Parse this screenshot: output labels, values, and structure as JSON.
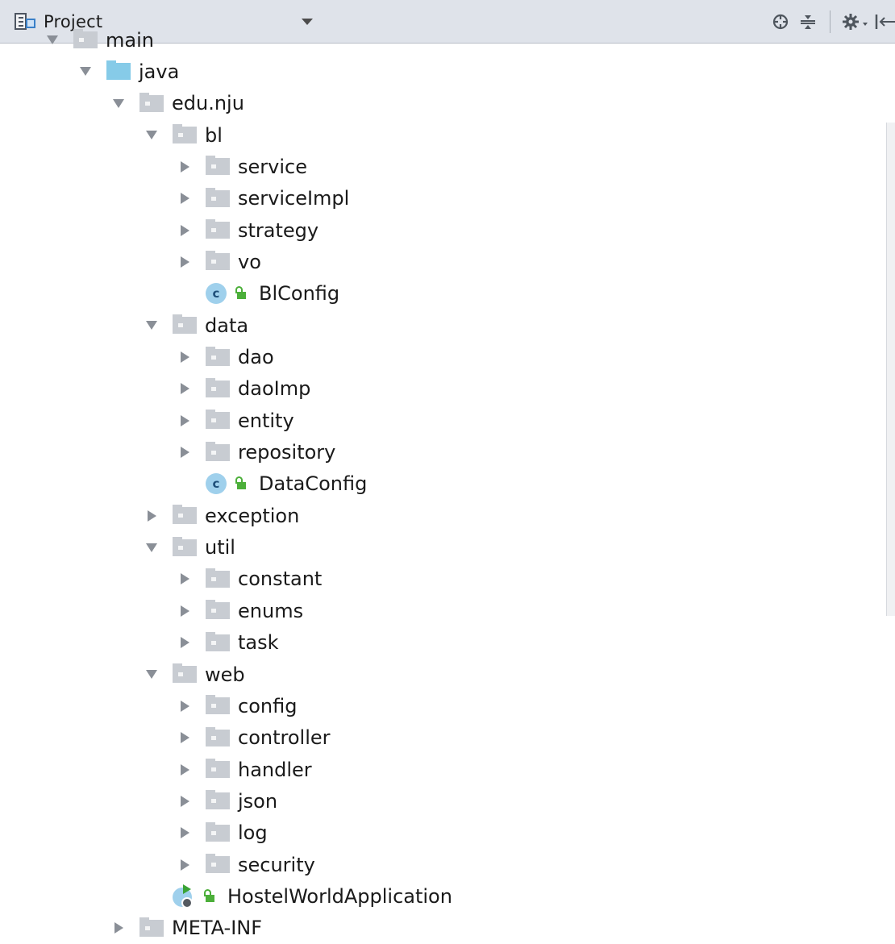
{
  "panel": {
    "title": "Project"
  },
  "tree": [
    {
      "label": "main",
      "level": 2,
      "arrow": "down",
      "icon": "folder"
    },
    {
      "label": "java",
      "level": 3,
      "arrow": "down",
      "icon": "folder-source"
    },
    {
      "label": "edu.nju",
      "level": 4,
      "arrow": "down",
      "icon": "package"
    },
    {
      "label": "bl",
      "level": 5,
      "arrow": "down",
      "icon": "package"
    },
    {
      "label": "service",
      "level": 6,
      "arrow": "right",
      "icon": "package"
    },
    {
      "label": "serviceImpl",
      "level": 6,
      "arrow": "right",
      "icon": "package"
    },
    {
      "label": "strategy",
      "level": 6,
      "arrow": "right",
      "icon": "package"
    },
    {
      "label": "vo",
      "level": 6,
      "arrow": "right",
      "icon": "package"
    },
    {
      "label": "BlConfig",
      "level": 6,
      "arrow": "none",
      "icon": "class"
    },
    {
      "label": "data",
      "level": 5,
      "arrow": "down",
      "icon": "package"
    },
    {
      "label": "dao",
      "level": 6,
      "arrow": "right",
      "icon": "package"
    },
    {
      "label": "daoImp",
      "level": 6,
      "arrow": "right",
      "icon": "package"
    },
    {
      "label": "entity",
      "level": 6,
      "arrow": "right",
      "icon": "package"
    },
    {
      "label": "repository",
      "level": 6,
      "arrow": "right",
      "icon": "package"
    },
    {
      "label": "DataConfig",
      "level": 6,
      "arrow": "none",
      "icon": "class"
    },
    {
      "label": "exception",
      "level": 5,
      "arrow": "right",
      "icon": "package"
    },
    {
      "label": "util",
      "level": 5,
      "arrow": "down",
      "icon": "package"
    },
    {
      "label": "constant",
      "level": 6,
      "arrow": "right",
      "icon": "package"
    },
    {
      "label": "enums",
      "level": 6,
      "arrow": "right",
      "icon": "package"
    },
    {
      "label": "task",
      "level": 6,
      "arrow": "right",
      "icon": "package"
    },
    {
      "label": "web",
      "level": 5,
      "arrow": "down",
      "icon": "package"
    },
    {
      "label": "config",
      "level": 6,
      "arrow": "right",
      "icon": "package"
    },
    {
      "label": "controller",
      "level": 6,
      "arrow": "right",
      "icon": "package"
    },
    {
      "label": "handler",
      "level": 6,
      "arrow": "right",
      "icon": "package"
    },
    {
      "label": "json",
      "level": 6,
      "arrow": "right",
      "icon": "package"
    },
    {
      "label": "log",
      "level": 6,
      "arrow": "right",
      "icon": "package"
    },
    {
      "label": "security",
      "level": 6,
      "arrow": "right",
      "icon": "package"
    },
    {
      "label": "HostelWorldApplication",
      "level": 5,
      "arrow": "none",
      "icon": "spring-boot-class"
    },
    {
      "label": "META-INF",
      "level": 4,
      "arrow": "right",
      "icon": "package"
    }
  ]
}
